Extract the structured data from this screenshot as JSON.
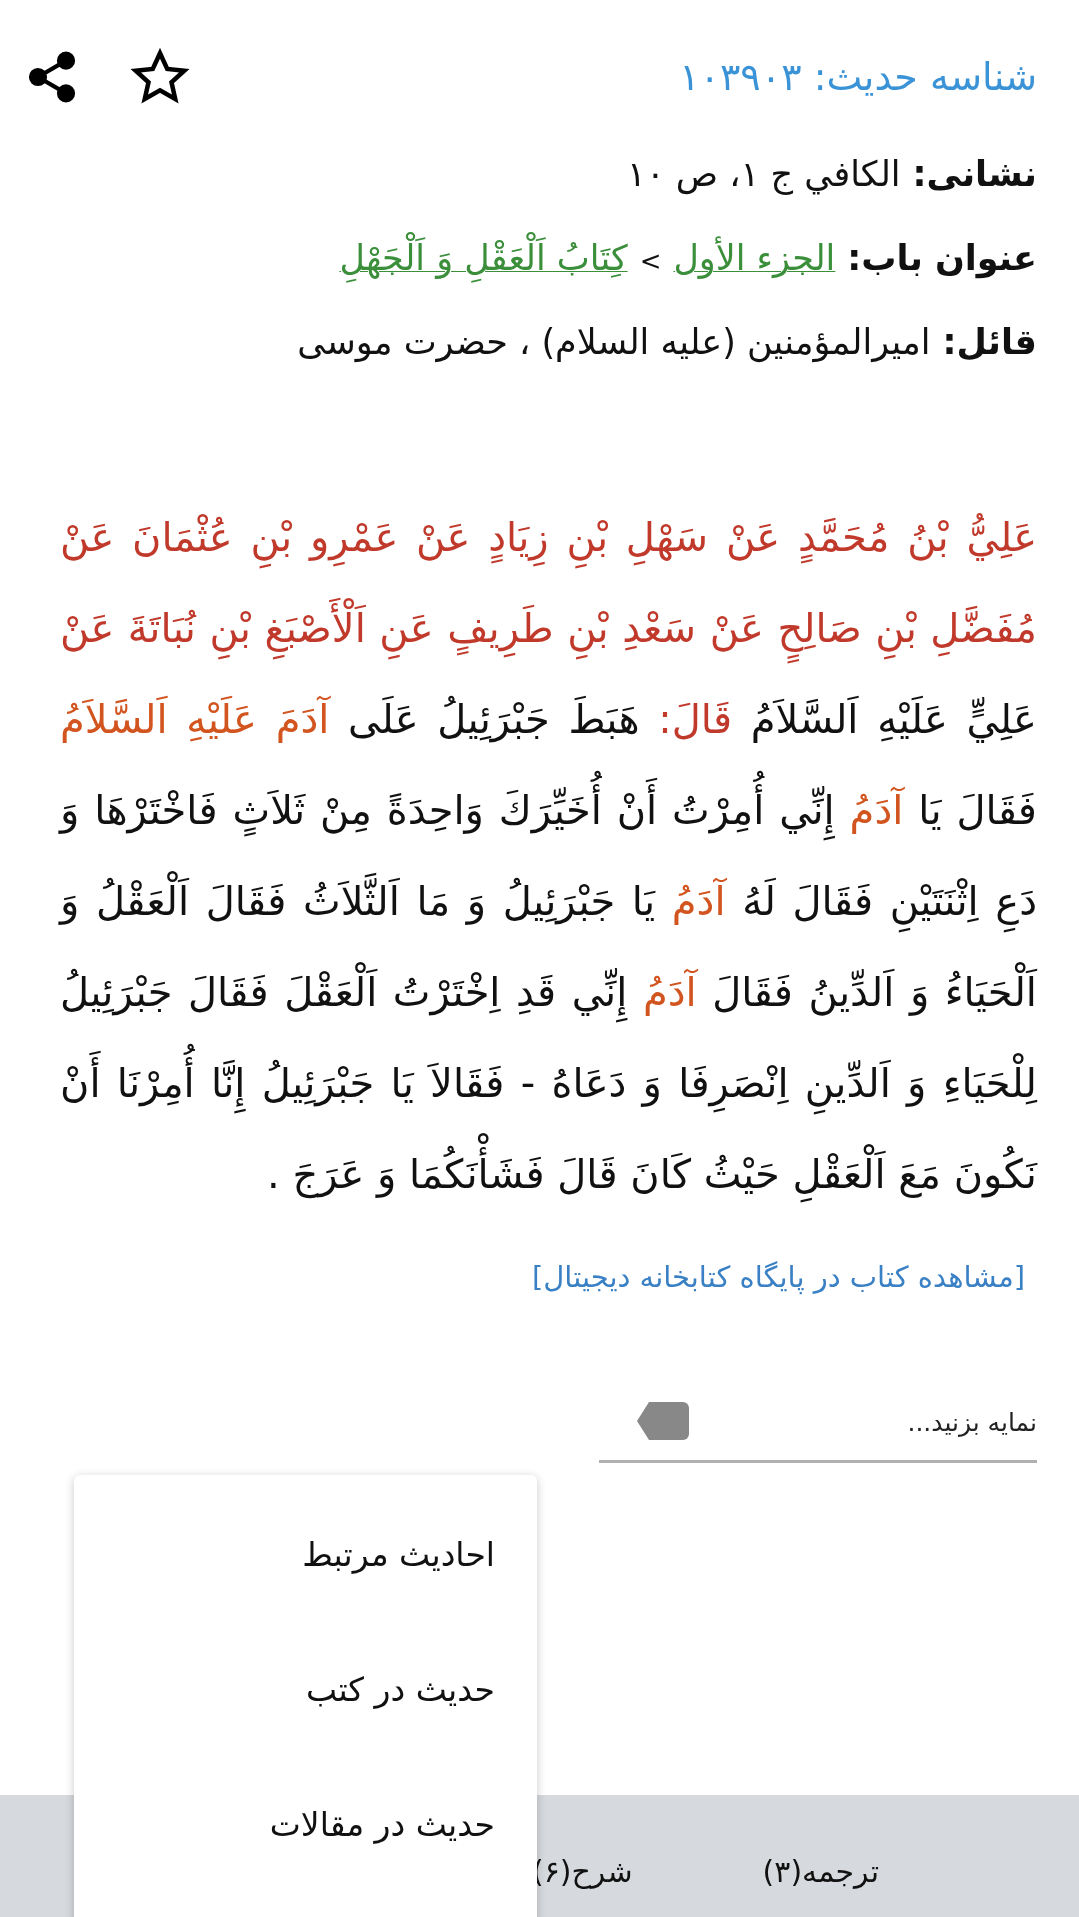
{
  "header": {
    "hadith_id": "شناسه حدیث: ۱۰۳۹۰۳"
  },
  "source": {
    "label": "نشانی:",
    "value": "الكافي ج ۱، ص ۱۰"
  },
  "chapter": {
    "label": "عنوان باب:",
    "links": [
      "الجزء الأول",
      "كِتَابُ اَلْعَقْلِ وَ اَلْجَهْلِ"
    ],
    "separator": ">"
  },
  "narrator": {
    "label": "قائل:",
    "value": "اميرالمؤمنين (عليه السلام) ، حضرت موسى"
  },
  "hadith": [
    {
      "kind": "isnad",
      "text": "عَلِيُّ بْنُ مُحَمَّدٍ عَنْ سَهْلِ بْنِ زِيَادٍ عَنْ عَمْرِو بْنِ عُثْمَانَ عَنْ مُفَضَّلِ بْنِ صَالِحٍ عَنْ سَعْدِ بْنِ طَرِيفٍ عَنِ اَلْأَصْبَغِ بْنِ نُبَاتَةَ عَنْ"
    },
    {
      "kind": "text",
      "text": " عَلِيٍّ عَلَيْهِ اَلسَّلاَمُ "
    },
    {
      "kind": "isnad",
      "text": "قَالَ:"
    },
    {
      "kind": "text",
      "text": " هَبَطَ جَبْرَئِيلُ عَلَى "
    },
    {
      "kind": "person",
      "text": "آدَمَ عَلَيْهِ اَلسَّلاَمُ"
    },
    {
      "kind": "text",
      "text": " فَقَالَ يَا "
    },
    {
      "kind": "person",
      "text": "آدَمُ"
    },
    {
      "kind": "text",
      "text": " إِنِّي أُمِرْتُ أَنْ أُخَيِّرَكَ وَاحِدَةً مِنْ ثَلاَثٍ فَاخْتَرْهَا وَ دَعِ اِثْنَتَيْنِ فَقَالَ لَهُ "
    },
    {
      "kind": "person",
      "text": "آدَمُ"
    },
    {
      "kind": "text",
      "text": " يَا جَبْرَئِيلُ وَ مَا اَلثَّلاَثُ فَقَالَ اَلْعَقْلُ وَ اَلْحَيَاءُ وَ اَلدِّينُ فَقَالَ "
    },
    {
      "kind": "person",
      "text": "آدَمُ"
    },
    {
      "kind": "text",
      "text": " إِنِّي قَدِ اِخْتَرْتُ اَلْعَقْلَ فَقَالَ جَبْرَئِيلُ لِلْحَيَاءِ وَ اَلدِّينِ اِنْصَرِفَا وَ دَعَاهُ - فَقَالاَ يَا جَبْرَئِيلُ إِنَّا أُمِرْنَا أَنْ نَكُونَ مَعَ اَلْعَقْلِ حَيْثُ كَانَ قَالَ فَشَأْنَكُمَا وَ عَرَجَ ."
    }
  ],
  "library_link": "[مشاهده کتاب در پایگاه کتابخانه دیجیتال]",
  "tag_field": {
    "placeholder": "نمایه بزنید..."
  },
  "bottom_tabs": [
    {
      "label": "ترجمه(۳)"
    },
    {
      "label": "شرح(۶)"
    }
  ],
  "menu": {
    "items": [
      "احادیث مرتبط",
      "حدیث در کتب",
      "حدیث در مقالات"
    ]
  }
}
